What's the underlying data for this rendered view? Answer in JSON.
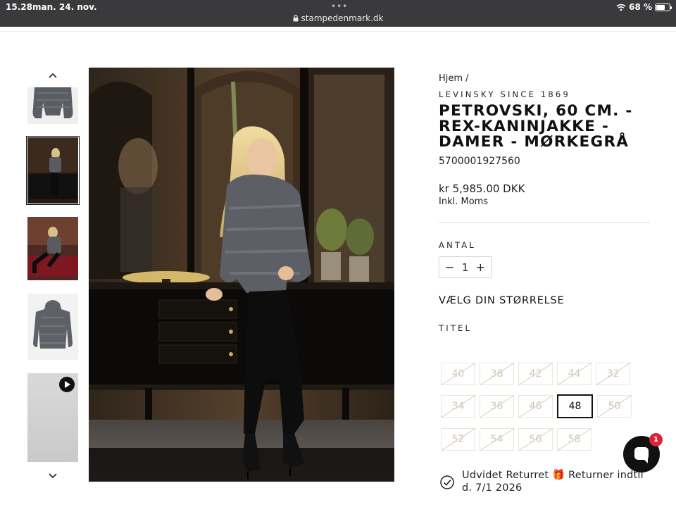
{
  "status_bar": {
    "time": "15.28",
    "date": "man. 24. nov.",
    "url": "stampedenmark.dk",
    "battery": "68 %",
    "battery_level": 0.68
  },
  "breadcrumb": "Hjem /",
  "product": {
    "vendor": "LEVINSKY SINCE 1869",
    "title": "PETROVSKI, 60 CM. - REX-KANINJAKKE - DAMER - MØRKEGRÅ",
    "sku": "5700001927560",
    "price": "kr 5,985.00 DKK",
    "tax_note": "Inkl. Moms"
  },
  "quantity": {
    "label": "ANTAL",
    "value": "1",
    "minus": "−",
    "plus": "+"
  },
  "size_heading": "VÆLG DIN STØRRELSE",
  "titel_label": "TITEL",
  "sizes": [
    [
      "40",
      "38",
      "42",
      "44",
      "32"
    ],
    [
      "34",
      "36",
      "46",
      "48",
      "50"
    ],
    [
      "52",
      "54",
      "56",
      "58"
    ]
  ],
  "selected_size": "48",
  "returns_text": "Udvidet Returret 🎁 Returner indtil d. 7/1 2026",
  "chat_badge": "1",
  "colors": {
    "accent_badge": "#d8243a",
    "chat_button": "#111111",
    "status_bar": "#3a3a3c"
  }
}
